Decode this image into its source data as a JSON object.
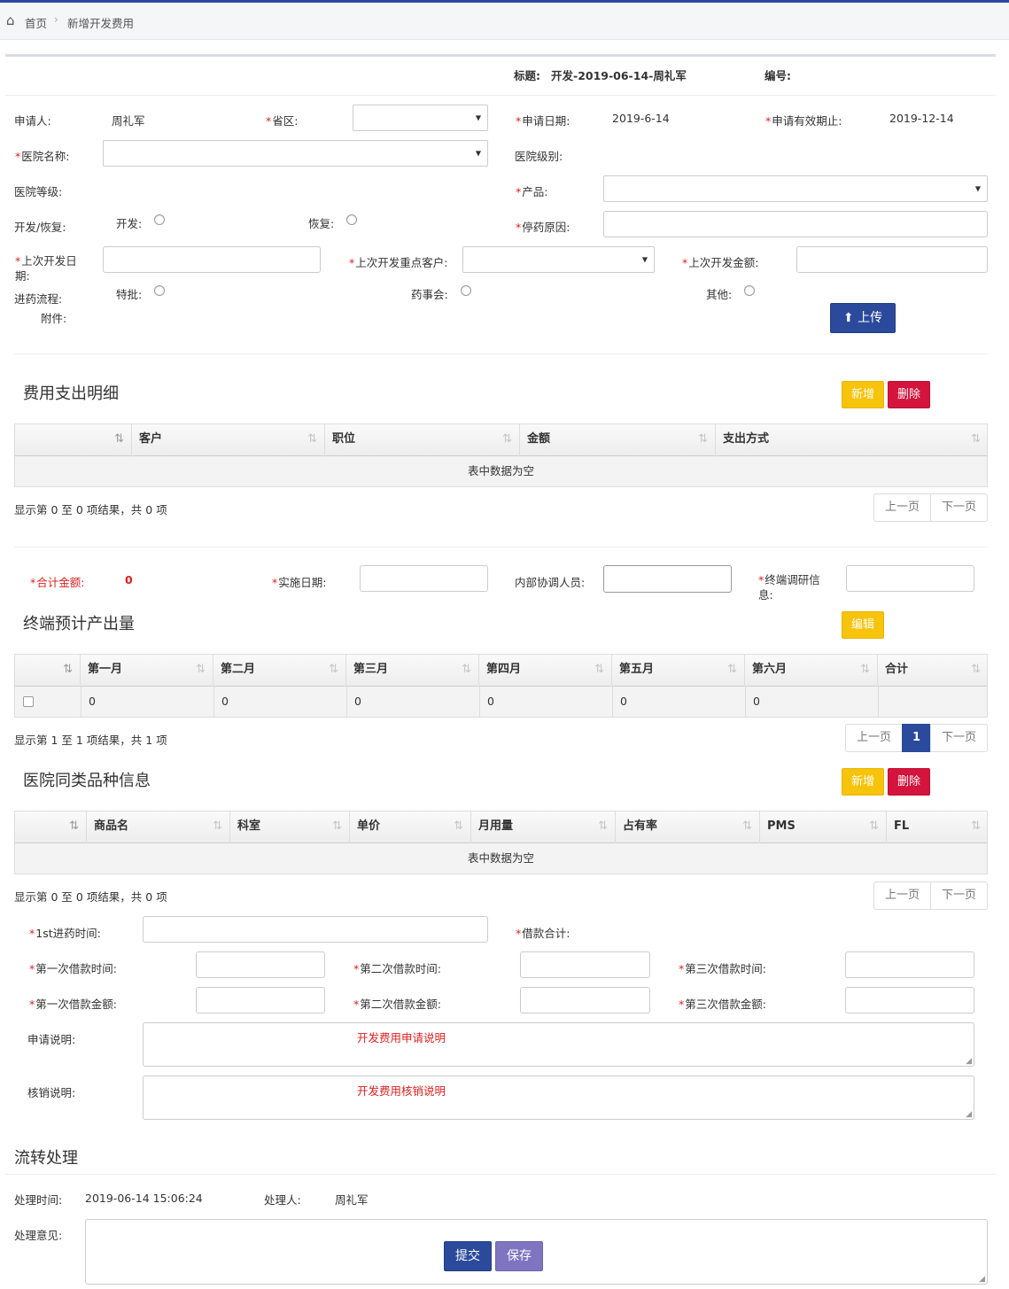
{
  "breadcrumb": {
    "home": "首页",
    "current": "新增开发费用"
  },
  "header": {
    "title_label": "标题:",
    "title_value": "开发-2019-06-14-周礼军",
    "number_label": "编号:"
  },
  "form": {
    "applicant_label": "申请人:",
    "applicant": "周礼军",
    "province_label": "省区:",
    "apply_date_label": "申请日期:",
    "apply_date": "2019-6-14",
    "valid_until_label": "申请有效期止:",
    "valid_until": "2019-12-14",
    "hospital_name_label": "医院名称:",
    "hospital_level_label": "医院级别:",
    "hospital_grade_label": "医院等级:",
    "product_label": "产品:",
    "dev_restore_label": "开发/恢复:",
    "dev_label": "开发:",
    "restore_label": "恢复:",
    "stop_reason_label": "停药原因:",
    "last_dev_date_label": "上次开发日期:",
    "last_key_customer_label": "上次开发重点客户:",
    "last_dev_amount_label": "上次开发金额:",
    "process_label": "进药流程:",
    "special_label": "特批:",
    "pharmacy_label": "药事会:",
    "other_label": "其他:",
    "attachment_label": "附件:",
    "upload_label": "上传"
  },
  "expense": {
    "title": "费用支出明细",
    "add": "新增",
    "delete": "删除",
    "columns": [
      "客户",
      "职位",
      "金额",
      "支出方式"
    ],
    "empty": "表中数据为空",
    "info": "显示第 0 至 0 项结果，共 0 项",
    "prev": "上一页",
    "next": "下一页"
  },
  "summary": {
    "total_label": "合计金额:",
    "total": "0",
    "impl_date_label": "实施日期:",
    "coordinator_label": "内部协调人员:",
    "terminal_info_label": "终端调研信息:"
  },
  "output": {
    "title": "终端预计产出量",
    "edit": "编辑",
    "columns": [
      "第一月",
      "第二月",
      "第三月",
      "第四月",
      "第五月",
      "第六月",
      "合计"
    ],
    "row": [
      "0",
      "0",
      "0",
      "0",
      "0",
      "0",
      ""
    ],
    "info": "显示第 1 至 1 项结果，共 1 项",
    "prev": "上一页",
    "page": "1",
    "next": "下一页"
  },
  "similar": {
    "title": "医院同类品种信息",
    "add": "新增",
    "delete": "删除",
    "columns": [
      "商品名",
      "科室",
      "单价",
      "月用量",
      "占有率",
      "PMS",
      "FL"
    ],
    "empty": "表中数据为空",
    "info": "显示第 0 至 0 项结果，共 0 项",
    "prev": "上一页",
    "next": "下一页"
  },
  "loan": {
    "first_time_label": "1st进药时间:",
    "loan_total_label": "借款合计:",
    "loan1_time": "第一次借款时间:",
    "loan2_time": "第二次借款时间:",
    "loan3_time": "第三次借款时间:",
    "loan1_amt": "第一次借款金额:",
    "loan2_amt": "第二次借款金额:",
    "loan3_amt": "第三次借款金额:",
    "apply_note_label": "申请说明:",
    "apply_note_ph": "开发费用申请说明",
    "verify_note_label": "核销说明:",
    "verify_note_ph": "开发费用核销说明"
  },
  "flow": {
    "title": "流转处理",
    "time_label": "处理时间:",
    "time": "2019-06-14 15:06:24",
    "handler_label": "处理人:",
    "handler": "周礼军",
    "opinion_label": "处理意见:",
    "submit": "提交",
    "save": "保存"
  }
}
